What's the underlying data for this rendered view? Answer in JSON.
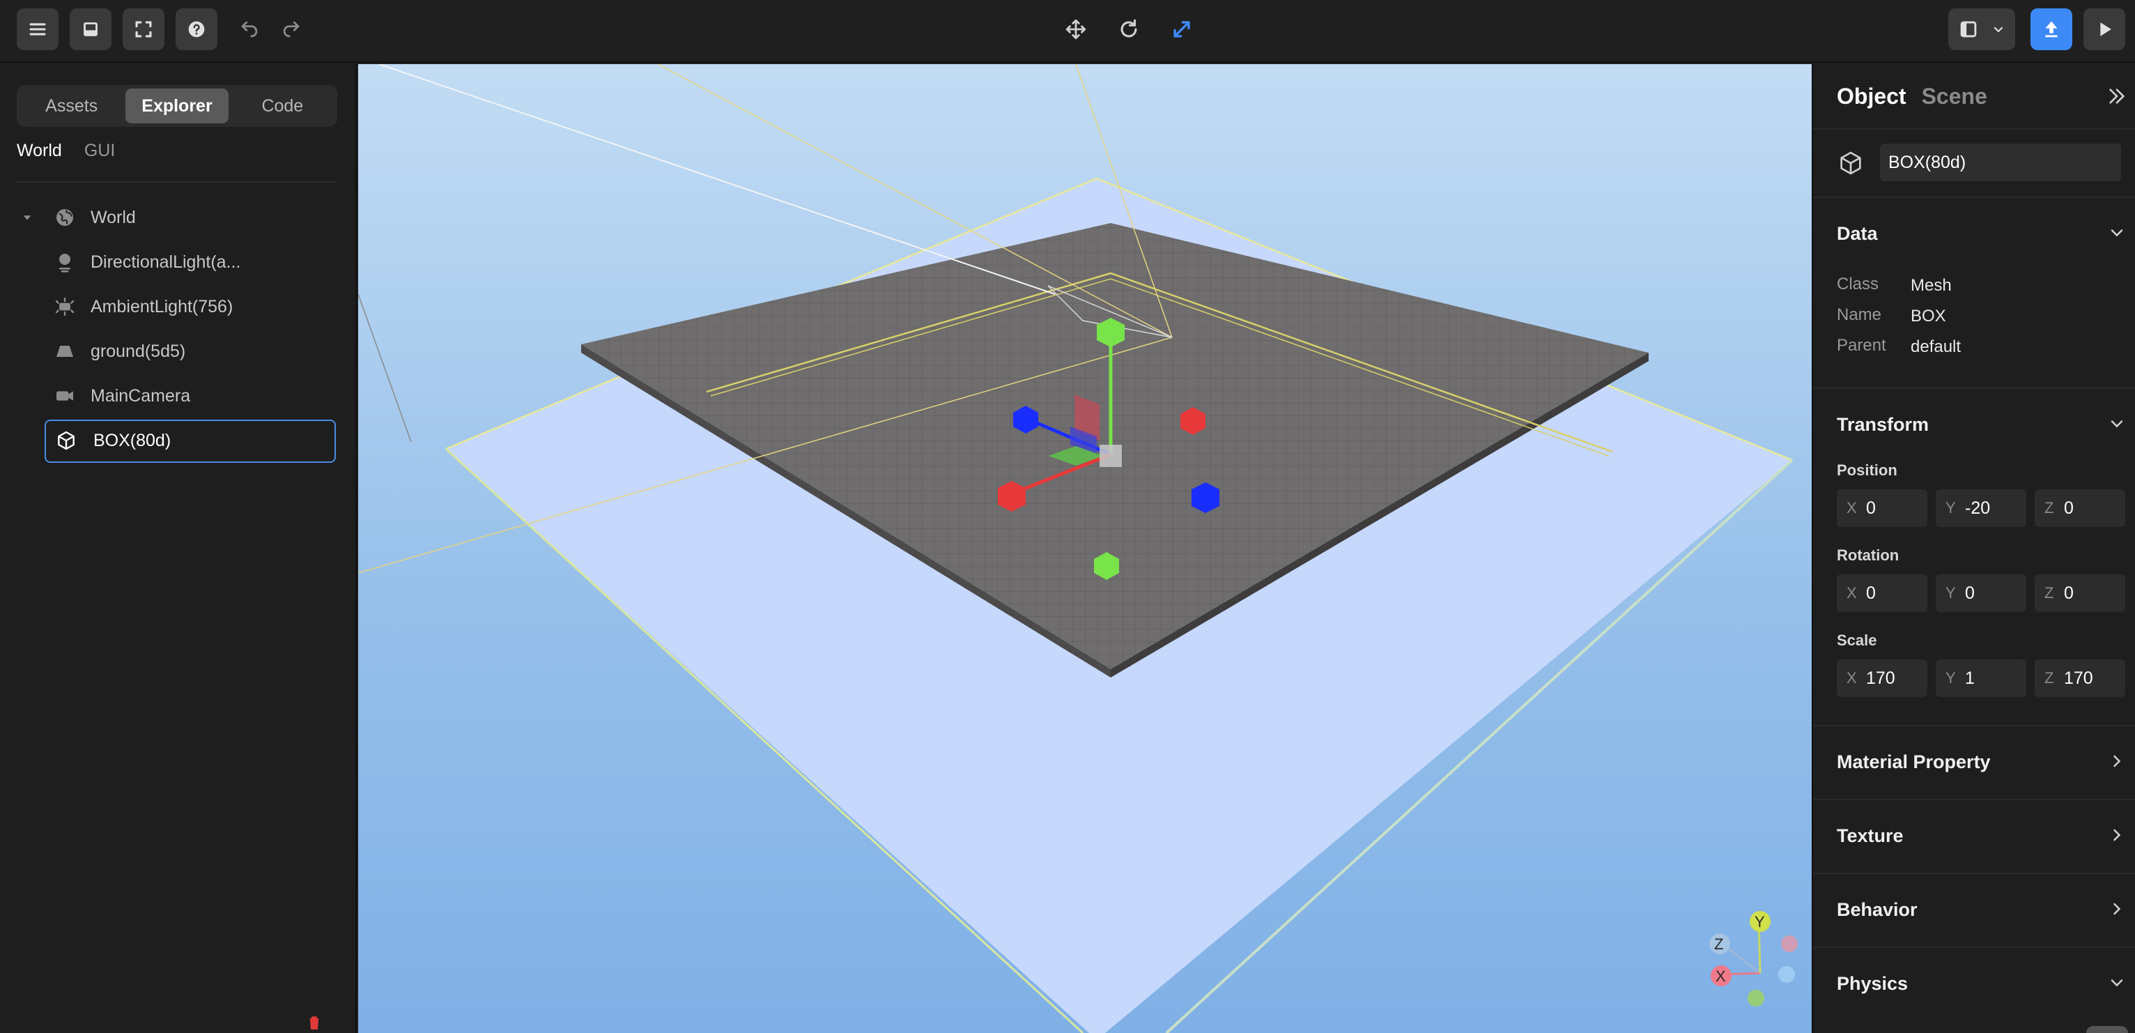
{
  "toolbar": {
    "left_icons": [
      "menu-icon",
      "inbox-icon",
      "fullscreen-icon",
      "help-icon",
      "undo-icon",
      "redo-icon"
    ],
    "center_icons": [
      "move-icon",
      "rotate-icon",
      "scale-icon"
    ],
    "right_icons": [
      "layout-icon",
      "chevron-down-icon",
      "publish-icon",
      "play-icon"
    ],
    "accent": "#3d8af7"
  },
  "left_panel": {
    "tabs": [
      {
        "label": "Assets",
        "active": false
      },
      {
        "label": "Explorer",
        "active": true
      },
      {
        "label": "Code",
        "active": false
      }
    ],
    "subtabs": [
      {
        "label": "World",
        "active": true
      },
      {
        "label": "GUI",
        "active": false
      }
    ],
    "tree": [
      {
        "label": "World",
        "icon": "globe-icon",
        "level": 0,
        "expanded": true
      },
      {
        "label": "DirectionalLight(a...",
        "icon": "directional-light-icon",
        "level": 1
      },
      {
        "label": "AmbientLight(756)",
        "icon": "ambient-light-icon",
        "level": 1
      },
      {
        "label": "ground(5d5)",
        "icon": "ground-icon",
        "level": 1
      },
      {
        "label": "MainCamera",
        "icon": "camera-icon",
        "level": 1
      },
      {
        "label": "BOX(80d)",
        "icon": "cube-icon",
        "level": 1,
        "selected": true
      }
    ],
    "selection_color": "#4a8be8"
  },
  "viewport": {
    "gizmo_axes": {
      "y": "Y",
      "z": "Z",
      "x": "X"
    },
    "colors": {
      "ground": "#6d6b6b",
      "plane": "#c6d8fb",
      "x": "#e8393a",
      "y": "#78e44a",
      "z": "#1a2dff"
    }
  },
  "right_panel": {
    "tabs": [
      {
        "label": "Object",
        "active": true
      },
      {
        "label": "Scene",
        "active": false
      }
    ],
    "object_name": "BOX(80d)",
    "data": {
      "title": "Data",
      "fields": [
        {
          "key": "Class",
          "value": "Mesh"
        },
        {
          "key": "Name",
          "value": "BOX"
        },
        {
          "key": "Parent",
          "value": "default"
        }
      ]
    },
    "transform": {
      "title": "Transform",
      "position": {
        "label": "Position",
        "x": "0",
        "y": "-20",
        "z": "0"
      },
      "rotation": {
        "label": "Rotation",
        "x": "0",
        "y": "0",
        "z": "0"
      },
      "scale": {
        "label": "Scale",
        "x": "170",
        "y": "1",
        "z": "170"
      },
      "axis_labels": {
        "x": "X",
        "y": "Y",
        "z": "Z"
      }
    },
    "sections": [
      {
        "title": "Material Property",
        "expanded": false
      },
      {
        "title": "Texture",
        "expanded": false
      },
      {
        "title": "Behavior",
        "expanded": false
      },
      {
        "title": "Physics",
        "expanded": true
      }
    ]
  }
}
